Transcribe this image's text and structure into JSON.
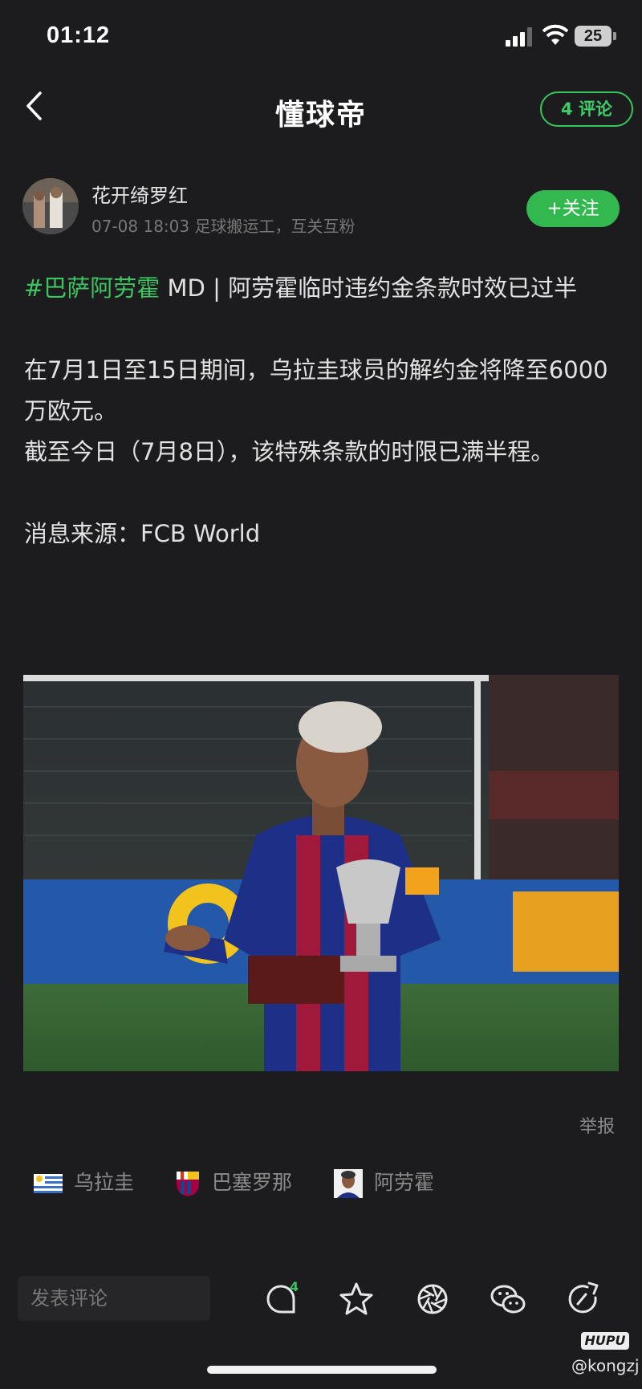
{
  "status_bar": {
    "time": "01:12",
    "battery": "25"
  },
  "nav": {
    "app_title": "懂球帝",
    "comments_pill": "4 评论"
  },
  "author": {
    "name": "花开绮罗红",
    "time_and_bio": "07-08 18:03  足球搬运工，互关互粉",
    "follow_label": "+关注"
  },
  "post": {
    "hashtag": "#巴萨阿劳霍",
    "title_rest": " MD | 阿劳霍临时违约金条款时效已过半",
    "para1": "在7月1日至15日期间，乌拉圭球员的解约金将降至6000万欧元。",
    "para2": "截至今日（7月8日），该特殊条款的时限已满半程。",
    "source": "消息来源：FCB World"
  },
  "report_label": "举报",
  "topics": [
    {
      "label": "乌拉圭",
      "icon": "uruguay-flag-icon"
    },
    {
      "label": "巴塞罗那",
      "icon": "barcelona-crest-icon"
    },
    {
      "label": "阿劳霍",
      "icon": "player-avatar-icon"
    }
  ],
  "bottom_bar": {
    "comment_placeholder": "发表评论",
    "comment_count": "4"
  },
  "watermark": {
    "brand": "HUPU",
    "handle": "@kongzj"
  },
  "colors": {
    "accent_green": "#35c759",
    "background": "#1c1c1e",
    "tag_green": "#3cc461"
  }
}
